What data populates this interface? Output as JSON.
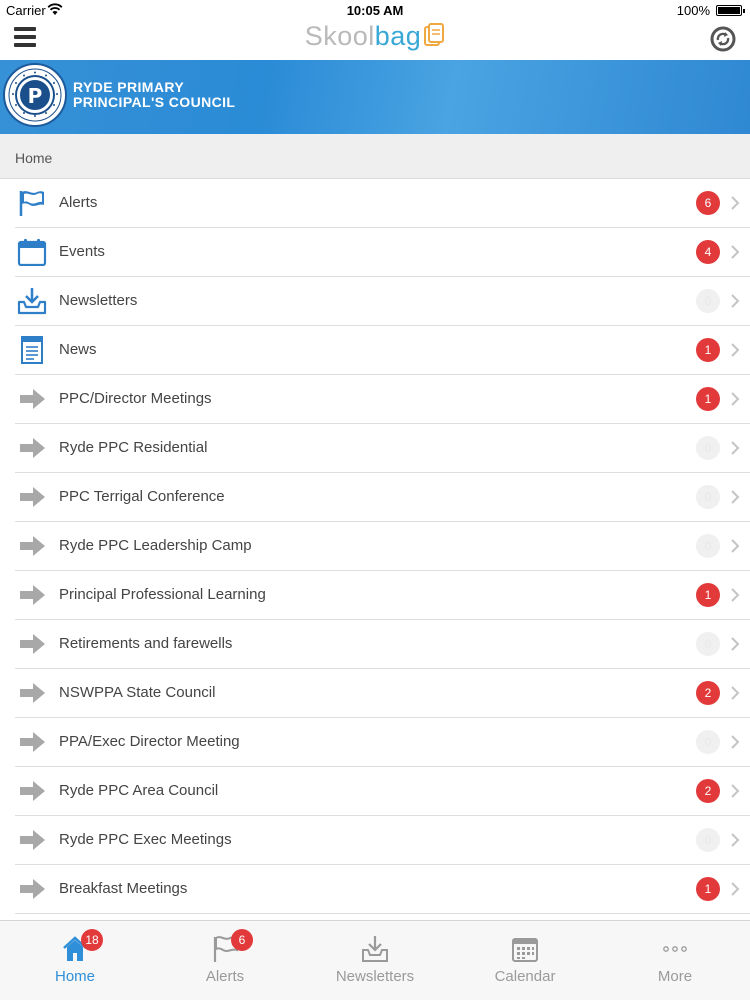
{
  "status_bar": {
    "carrier": "Carrier",
    "time": "10:05 AM",
    "battery": "100%"
  },
  "nav": {
    "brand_part1": "Skool",
    "brand_part2": "bag",
    "accent_color": "#39a8d6"
  },
  "banner": {
    "line1": "RYDE PRIMARY",
    "line2": "PRINCIPAL'S COUNCIL"
  },
  "breadcrumb": "Home",
  "items": [
    {
      "label": "Alerts",
      "icon": "flag-icon",
      "badge": "6",
      "badge_active": true
    },
    {
      "label": "Events",
      "icon": "calendar-icon",
      "badge": "4",
      "badge_active": true
    },
    {
      "label": "Newsletters",
      "icon": "inbox-download-icon",
      "badge": "0",
      "badge_active": false
    },
    {
      "label": "News",
      "icon": "document-icon",
      "badge": "1",
      "badge_active": true
    },
    {
      "label": "PPC/Director Meetings",
      "icon": "arrow-right-icon",
      "badge": "1",
      "badge_active": true
    },
    {
      "label": "Ryde PPC Residential",
      "icon": "arrow-right-icon",
      "badge": "0",
      "badge_active": false
    },
    {
      "label": "PPC Terrigal Conference",
      "icon": "arrow-right-icon",
      "badge": "0",
      "badge_active": false
    },
    {
      "label": "Ryde PPC Leadership Camp",
      "icon": "arrow-right-icon",
      "badge": "0",
      "badge_active": false
    },
    {
      "label": "Principal Professional Learning",
      "icon": "arrow-right-icon",
      "badge": "1",
      "badge_active": true
    },
    {
      "label": "Retirements and farewells",
      "icon": "arrow-right-icon",
      "badge": "0",
      "badge_active": false
    },
    {
      "label": "NSWPPA State Council",
      "icon": "arrow-right-icon",
      "badge": "2",
      "badge_active": true
    },
    {
      "label": "PPA/Exec Director Meeting",
      "icon": "arrow-right-icon",
      "badge": "0",
      "badge_active": false
    },
    {
      "label": "Ryde PPC Area Council",
      "icon": "arrow-right-icon",
      "badge": "2",
      "badge_active": true
    },
    {
      "label": "Ryde PPC Exec Meetings",
      "icon": "arrow-right-icon",
      "badge": "0",
      "badge_active": false
    },
    {
      "label": "Breakfast Meetings",
      "icon": "arrow-right-icon",
      "badge": "1",
      "badge_active": true
    }
  ],
  "tabs": [
    {
      "label": "Home",
      "icon": "home-icon",
      "badge": "18",
      "active": true
    },
    {
      "label": "Alerts",
      "icon": "flag-icon",
      "badge": "6",
      "active": false
    },
    {
      "label": "Newsletters",
      "icon": "inbox-download-icon",
      "badge": "",
      "active": false
    },
    {
      "label": "Calendar",
      "icon": "calendar-icon",
      "badge": "",
      "active": false
    },
    {
      "label": "More",
      "icon": "more-dots-icon",
      "badge": "",
      "active": false
    }
  ],
  "colors": {
    "badge_red": "#e2393a",
    "active_blue": "#2f8fd8",
    "banner_blue": "#2a8bd6"
  }
}
